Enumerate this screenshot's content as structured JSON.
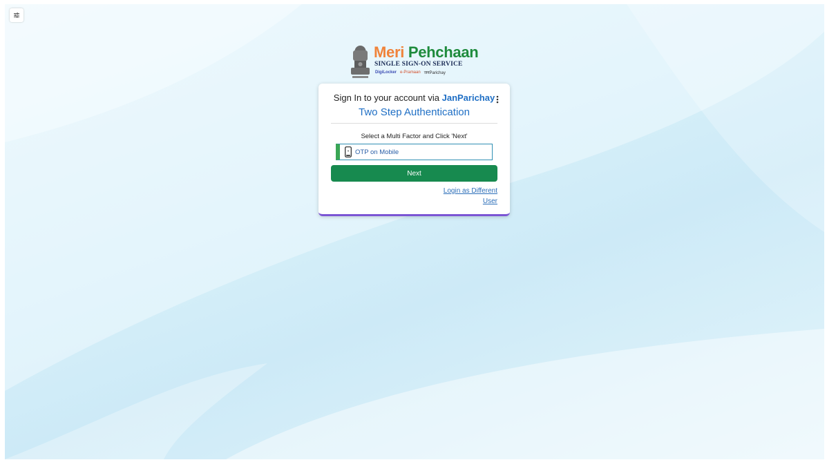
{
  "brand": {
    "title_part1": "Meri",
    "title_part2": "Pehchaan",
    "subtitle": "SINGLE SIGN-ON SERVICE",
    "partner_digilocker": "DigiLocker",
    "partner_epramaan": "e-Pramaan",
    "partner_janparichay": "जनParichay"
  },
  "card": {
    "signin_prefix": "Sign In to your account via",
    "signin_provider": "JanParichay",
    "heading": "Two Step Authentication",
    "select_label": "Select a Multi Factor and Click 'Next'",
    "option_label": "OTP on Mobile",
    "next_label": "Next",
    "different_user_link": "Login as Different User"
  },
  "colors": {
    "accent_blue": "#1f6fc5",
    "next_green": "#178a4f",
    "card_border_purple": "#7b55d4",
    "option_green": "#3aa655"
  },
  "icons": {
    "settings": "sliders-icon",
    "menu": "kebab-menu-icon",
    "option": "mobile-phone-icon"
  }
}
